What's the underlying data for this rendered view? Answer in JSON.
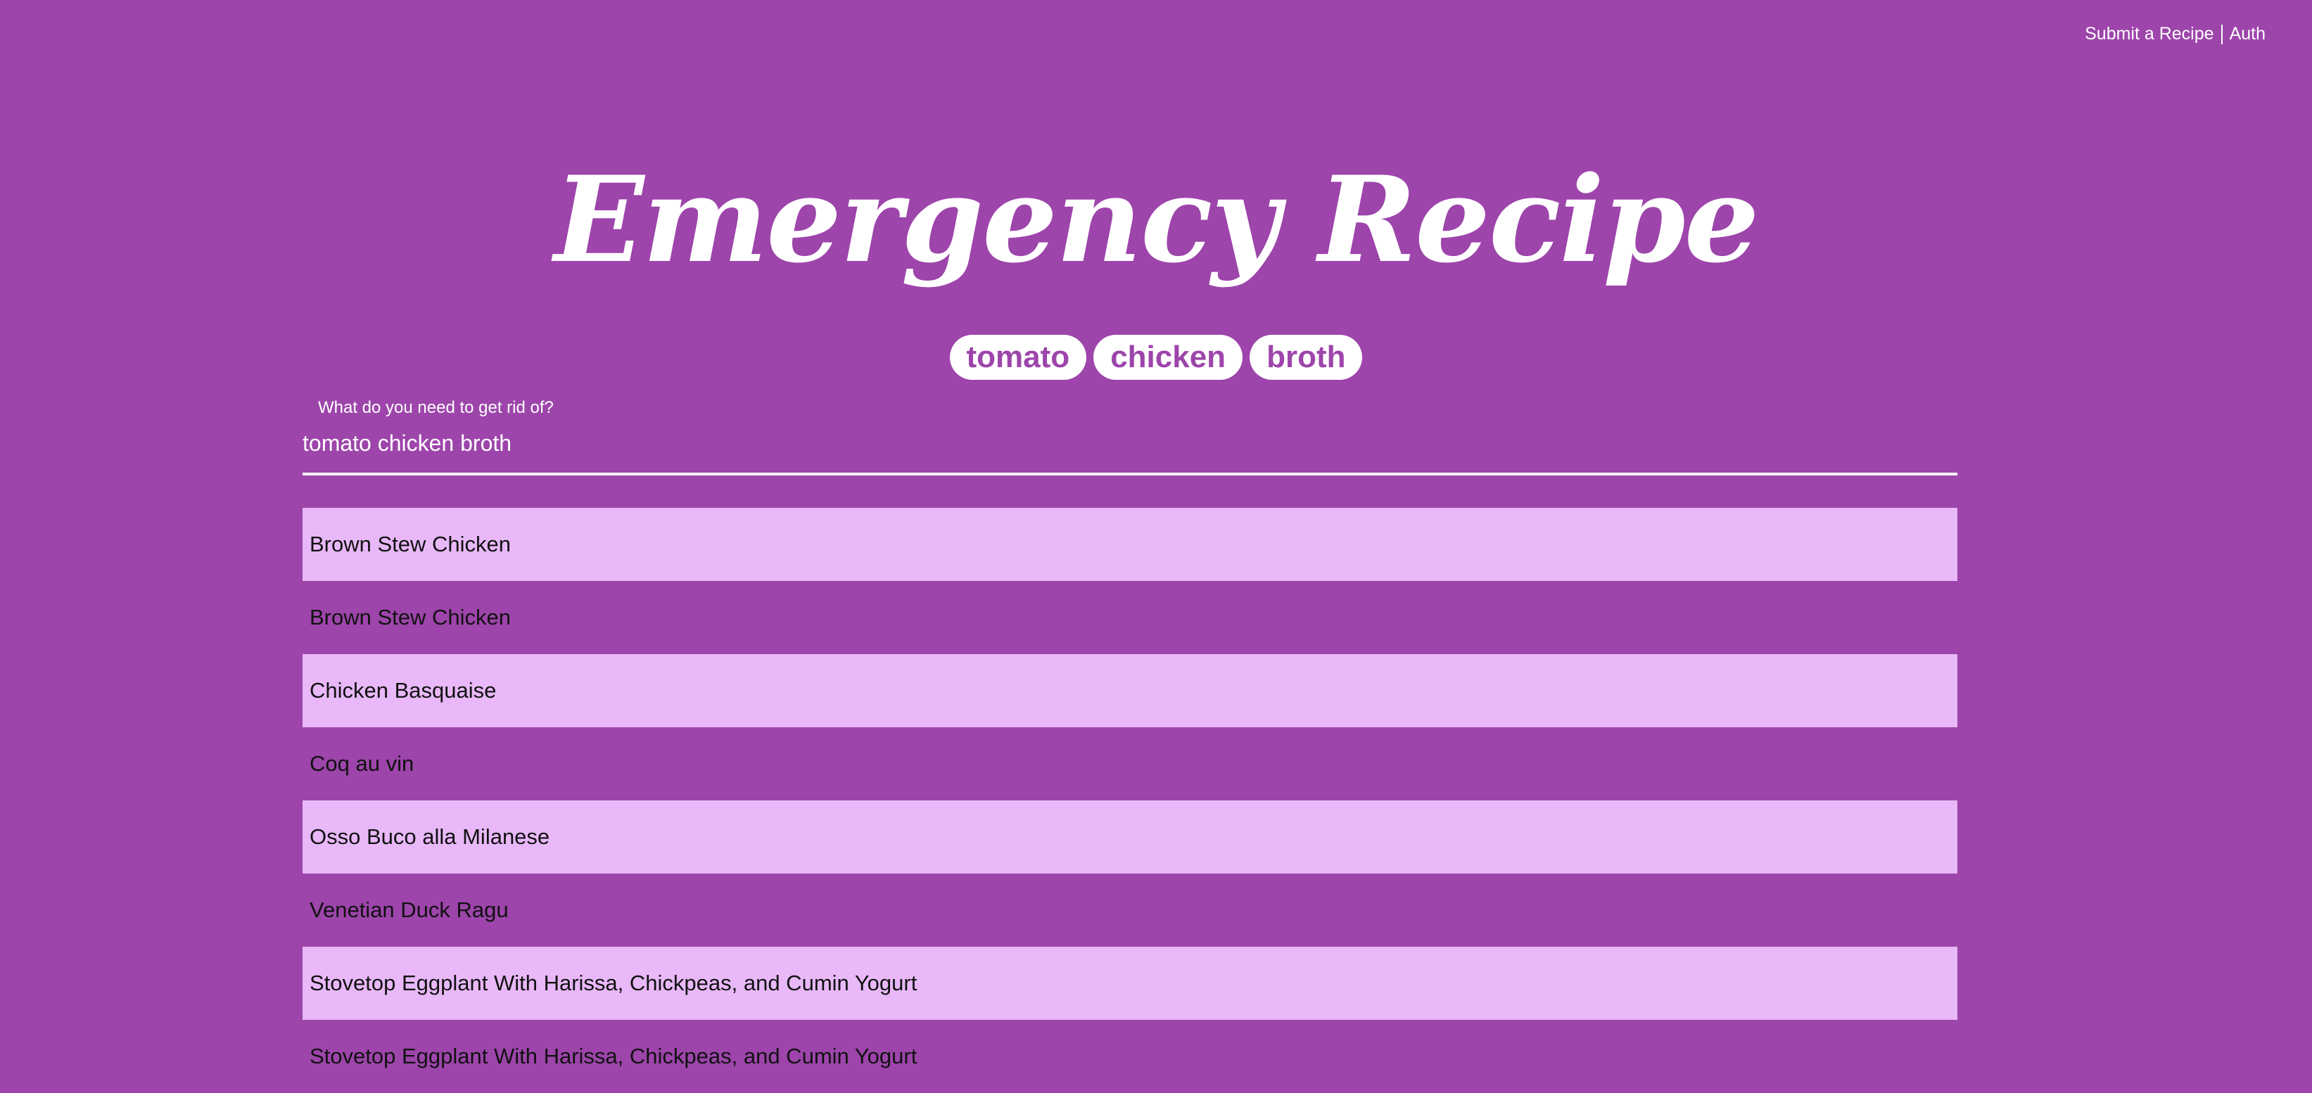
{
  "nav": {
    "submit_label": "Submit a Recipe",
    "auth_label": "Auth"
  },
  "header": {
    "title": "Emergency Recipe"
  },
  "tags": [
    "tomato",
    "chicken",
    "broth"
  ],
  "search": {
    "label": "What do you need to get rid of?",
    "value": "tomato chicken broth"
  },
  "results": [
    "Brown Stew Chicken",
    "Brown Stew Chicken",
    "Chicken Basquaise",
    "Coq au vin",
    "Osso Buco alla Milanese",
    "Venetian Duck Ragu",
    "Stovetop Eggplant With Harissa, Chickpeas, and Cumin Yogurt",
    "Stovetop Eggplant With Harissa, Chickpeas, and Cumin Yogurt"
  ],
  "colors": {
    "background": "#9d45ab",
    "row_highlight": "#e8b8f8",
    "text_light": "#ffffff",
    "text_dark": "#111111"
  }
}
